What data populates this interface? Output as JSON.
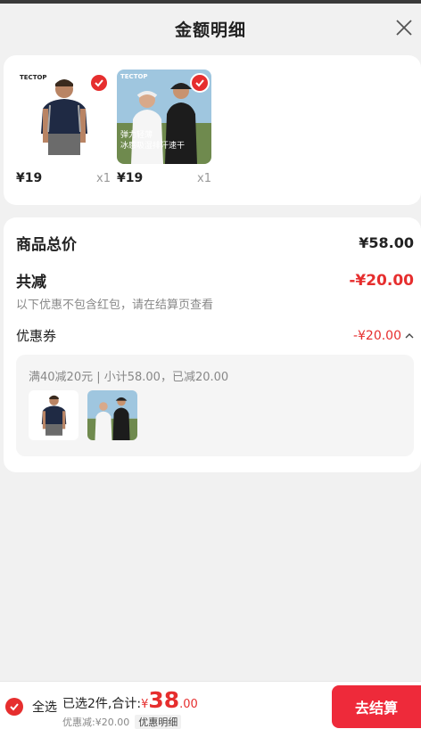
{
  "header": {
    "title": "金额明细"
  },
  "colors": {
    "accent": "#e62e2e",
    "checkout": "#ee2a3a"
  },
  "products": [
    {
      "brand": "TECTOP",
      "price": "¥19",
      "qty": "x1",
      "checked": true
    },
    {
      "brand": "TECTOP",
      "overlay_line1": "弹力轻薄",
      "overlay_line2": "冰感吸湿排汗速干",
      "price": "¥19",
      "qty": "x1",
      "checked": true
    }
  ],
  "summary": {
    "total_label": "商品总价",
    "total_value": "¥58.00",
    "discount_label": "共减",
    "discount_value": "-¥20.00",
    "note": "以下优惠不包含红包，请在结算页查看",
    "coupon_label": "优惠券",
    "coupon_value": "-¥20.00",
    "coupon_desc": "满40减20元 | 小计58.00，已减20.00"
  },
  "bottom": {
    "select_all": "全选",
    "selected_total_prefix": "已选2件,合计:",
    "currency": "¥",
    "amount_int": "38",
    "amount_dec": ".00",
    "discount_text": "优惠减:¥20.00",
    "detail_label": "优惠明细",
    "checkout_label": "去结算"
  }
}
